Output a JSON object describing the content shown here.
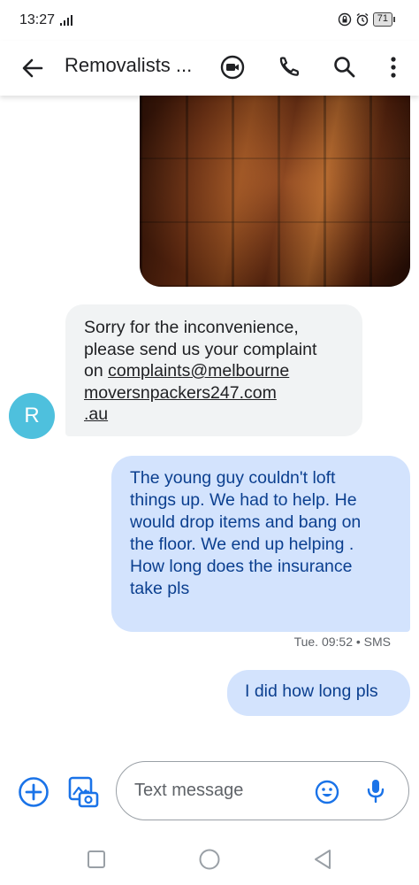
{
  "status_bar": {
    "time": "13:27",
    "battery": "71"
  },
  "app_bar": {
    "title": "Removalists ...",
    "icons": [
      "back-arrow-icon",
      "video-call-icon",
      "phone-icon",
      "search-icon",
      "more-vert-icon"
    ]
  },
  "messages": [
    {
      "direction": "incoming",
      "type": "image",
      "description": "wooden floor photo"
    },
    {
      "direction": "incoming",
      "sender_initial": "R",
      "lines": [
        "Sorry for the inconvenience,",
        "please send us your complaint",
        "on "
      ],
      "link_lines": [
        "complaints@melbourne",
        "moversnpackers247.com",
        ".au"
      ]
    },
    {
      "direction": "outgoing",
      "lines": [
        "The young guy couldn't loft",
        "things up. We had to help.  He",
        "would drop items and bang on",
        "the floor. We end up helping .",
        "How long does the insurance",
        "take pls"
      ],
      "meta": "Tue. 09:52 • SMS"
    },
    {
      "direction": "outgoing",
      "text": "I did how long pls"
    }
  ],
  "compose": {
    "placeholder": "Text message"
  },
  "colors": {
    "outgoing_bubble": "#d3e3fd",
    "outgoing_text": "#0b3f8f",
    "incoming_bubble": "#f1f3f4",
    "avatar": "#4ec0dd",
    "accent": "#1a73e8"
  }
}
